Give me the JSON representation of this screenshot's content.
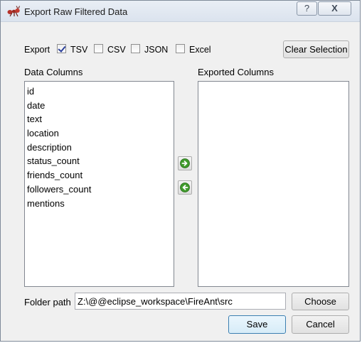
{
  "window": {
    "title": "Export Raw Filtered Data",
    "help_label": "?",
    "close_label": "X"
  },
  "export": {
    "label": "Export",
    "formats": [
      {
        "label": "TSV",
        "checked": true
      },
      {
        "label": "CSV",
        "checked": false
      },
      {
        "label": "JSON",
        "checked": false
      },
      {
        "label": "Excel",
        "checked": false
      }
    ],
    "clear_label": "Clear Selection"
  },
  "data_columns": {
    "label": "Data Columns",
    "items": [
      "id",
      "date",
      "text",
      "location",
      "description",
      "status_count",
      "friends_count",
      "followers_count",
      "mentions"
    ]
  },
  "exported_columns": {
    "label": "Exported Columns",
    "items": []
  },
  "folder": {
    "label": "Folder path",
    "value": "Z:\\@@eclipse_workspace\\FireAnt\\src",
    "choose_label": "Choose"
  },
  "footer": {
    "save_label": "Save",
    "cancel_label": "Cancel"
  },
  "colors": {
    "arrow_green": "#3f9a2b",
    "default_button_border": "#3c7fb1",
    "checkmark": "#2a3f9a"
  },
  "icons": {
    "app": "ant-icon",
    "add": "arrow-right-icon",
    "remove": "arrow-left-icon"
  }
}
